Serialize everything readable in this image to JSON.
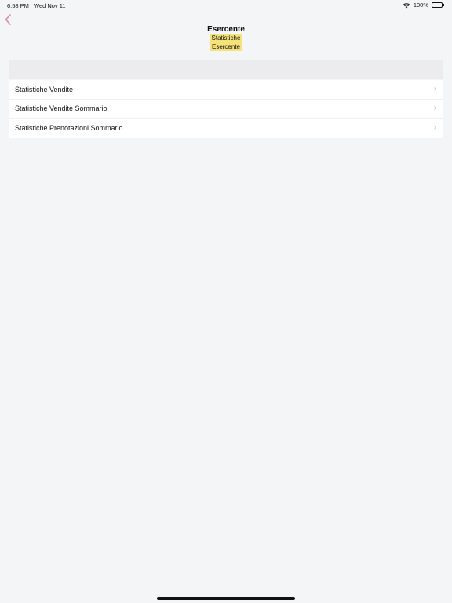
{
  "status_bar": {
    "time": "6:58 PM",
    "date": "Wed Nov 11",
    "battery": "100%"
  },
  "navbar": {
    "title": "Esercente",
    "breadcrumb": [
      "Statistiche",
      "Esercente"
    ],
    "back_icon": "chevron-left-icon",
    "accent_color": "#e08a9a"
  },
  "list": {
    "items": [
      {
        "label": "Statistiche Vendite"
      },
      {
        "label": "Statistiche Vendite Sommario"
      },
      {
        "label": "Statistiche Prenotazioni Sommario"
      }
    ]
  }
}
